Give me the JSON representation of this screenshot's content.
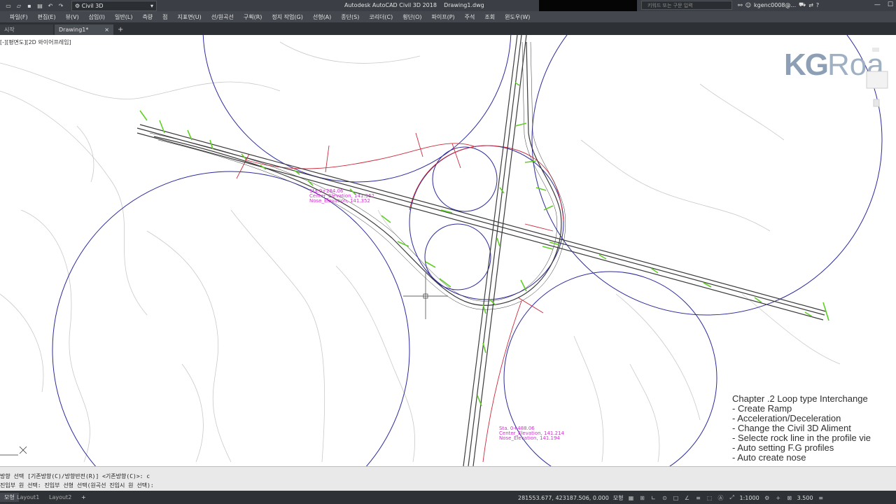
{
  "titlebar": {
    "workspace": "Civil 3D",
    "app_title": "Autodesk AutoCAD Civil 3D 2018",
    "file_name": "Drawing1.dwg",
    "search_placeholder": "키워드 또는 구문 입력",
    "user": "kgenc0008@..."
  },
  "menu": [
    "파일(F)",
    "편집(E)",
    "뷰(V)",
    "삽입(I)",
    "일반(L)",
    "측량",
    "점",
    "지표면(U)",
    "선/원곡선",
    "구획(R)",
    "정지 작업(G)",
    "선형(A)",
    "종단(S)",
    "코리더(C)",
    "횡단(O)",
    "파이프(P)",
    "주석",
    "조회",
    "윈도우(W)"
  ],
  "tabs": {
    "start": "시작",
    "active": "Drawing1*"
  },
  "viewport_label": "[-][평면도][2D 와이어프레임]",
  "command": {
    "line1": "방향 선택 [기존방향(C)/방향반전(R)] <기존방향(C)>: c",
    "line2": "진입부 원 선택: 진입부 선형 선택(원곡선 진입시 원 선택):"
  },
  "layouts": [
    "모형",
    "Layout1",
    "Layout2"
  ],
  "status": {
    "coords": "281553.677, 423187.506, 0.000",
    "model": "모형",
    "scale": "1:1000",
    "value": "3.500"
  },
  "logo": {
    "strong": "KG",
    "rest": "Roa"
  },
  "chapter": {
    "title": "Chapter .2 Loop type Interchange",
    "items": [
      "- Create Ramp",
      "- Acceleration/Deceleration",
      "- Change the Civil 3D Aliment",
      "- Selecte rock line in the profile vie",
      "- Auto setting F.G profiles",
      "- Auto create nose"
    ]
  },
  "annotations": {
    "a1": [
      "Sta. 0+488.06",
      "Center_Elevation, 141.214",
      "Nose_Elevation, 141.194"
    ],
    "a2": [
      "Sta.0+284.06",
      "Center_Elevation, 141.362",
      "Nose_Elevation, 141.352"
    ]
  }
}
